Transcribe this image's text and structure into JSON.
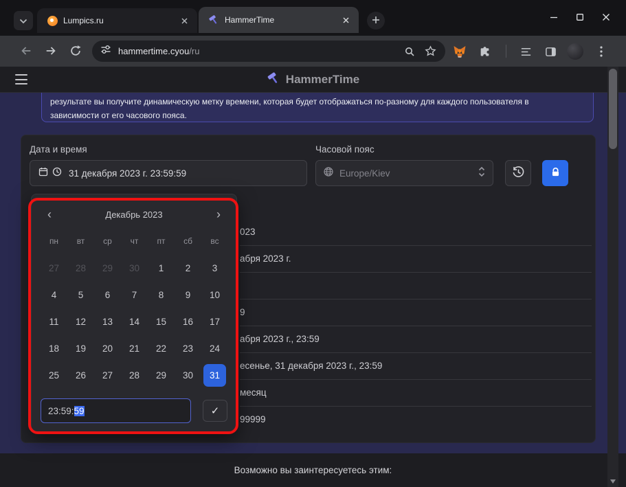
{
  "browser": {
    "tabs": [
      {
        "title": "Lumpics.ru"
      },
      {
        "title": "HammerTime"
      }
    ],
    "address": {
      "host": "hammertime.cyou",
      "path": "/ru"
    }
  },
  "site": {
    "title": "HammerTime",
    "intro_lines": [
      "результате вы получите динамическую метку времени, которая будет отображаться по-разному для каждого пользователя в",
      "зависимости от его часового пояса."
    ],
    "form": {
      "datetime_label": "Дата и время",
      "datetime_value": "31 декабря 2023 г. 23:59:59",
      "timezone_label": "Часовой пояс",
      "timezone_value": "Europe/Kiev"
    },
    "calendar": {
      "prev": "‹",
      "month": "Декабрь 2023",
      "next": "›",
      "weekdays": [
        "пн",
        "вт",
        "ср",
        "чт",
        "пт",
        "сб",
        "вс"
      ],
      "days": [
        {
          "label": "27",
          "muted": true
        },
        {
          "label": "28",
          "muted": true
        },
        {
          "label": "29",
          "muted": true
        },
        {
          "label": "30",
          "muted": true
        },
        {
          "label": "1"
        },
        {
          "label": "2"
        },
        {
          "label": "3"
        },
        {
          "label": "4"
        },
        {
          "label": "5"
        },
        {
          "label": "6"
        },
        {
          "label": "7"
        },
        {
          "label": "8"
        },
        {
          "label": "9"
        },
        {
          "label": "10"
        },
        {
          "label": "11"
        },
        {
          "label": "12"
        },
        {
          "label": "13"
        },
        {
          "label": "14"
        },
        {
          "label": "15"
        },
        {
          "label": "16"
        },
        {
          "label": "17"
        },
        {
          "label": "18"
        },
        {
          "label": "19"
        },
        {
          "label": "20"
        },
        {
          "label": "21"
        },
        {
          "label": "22"
        },
        {
          "label": "23"
        },
        {
          "label": "24"
        },
        {
          "label": "25"
        },
        {
          "label": "26"
        },
        {
          "label": "27"
        },
        {
          "label": "28"
        },
        {
          "label": "29"
        },
        {
          "label": "30"
        },
        {
          "label": "31",
          "selected": true
        }
      ],
      "time_prefix": "23:59:",
      "time_selected": "59",
      "confirm": "✓"
    },
    "results_fragments": [
      "023",
      "абря 2023 г.",
      "",
      "9",
      "абря 2023 г., 23:59",
      "есенье, 31 декабря 2023 г., 23:59",
      "месяц",
      "99999"
    ],
    "footer": "Возможно вы заинтересуетесь этим:",
    "accent_colors": {
      "selection_blue": "#2d63dd",
      "lock_blue": "#2b6bea",
      "annotation_red": "#ee1212"
    }
  }
}
